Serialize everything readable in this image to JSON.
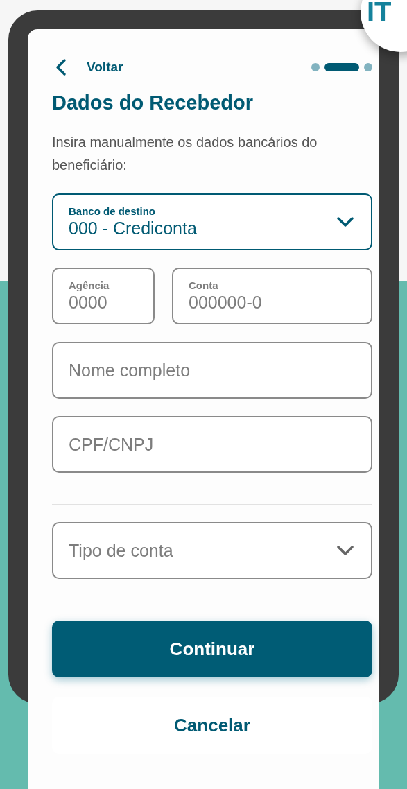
{
  "badge": {
    "text": "IT"
  },
  "header": {
    "back_label": "Voltar",
    "steps": [
      {
        "selected": false
      },
      {
        "selected": true
      },
      {
        "selected": false
      }
    ]
  },
  "title": "Dados do Recebedor",
  "description": "Insira manualmente os dados bancários do beneficiário:",
  "field_rows": [
    [
      {
        "kind": "select",
        "label": "Banco de destino",
        "value": "000 - Crediconta"
      }
    ],
    [
      {
        "kind": "text",
        "label": "Agência",
        "placeholder": "0000"
      },
      {
        "kind": "text",
        "label": "Conta",
        "placeholder": "000000-0"
      }
    ],
    [
      {
        "kind": "text",
        "placeholder": "Nome completo"
      }
    ],
    [
      {
        "kind": "text",
        "placeholder": "CPF/CNPJ"
      }
    ],
    [
      {
        "kind": "divider"
      }
    ],
    [
      {
        "kind": "select",
        "placeholder": "Tipo de conta"
      }
    ]
  ],
  "buttons": [
    {
      "label": "Continuar",
      "kind": "primary"
    },
    {
      "label": "Cancelar",
      "kind": "secondary"
    }
  ]
}
